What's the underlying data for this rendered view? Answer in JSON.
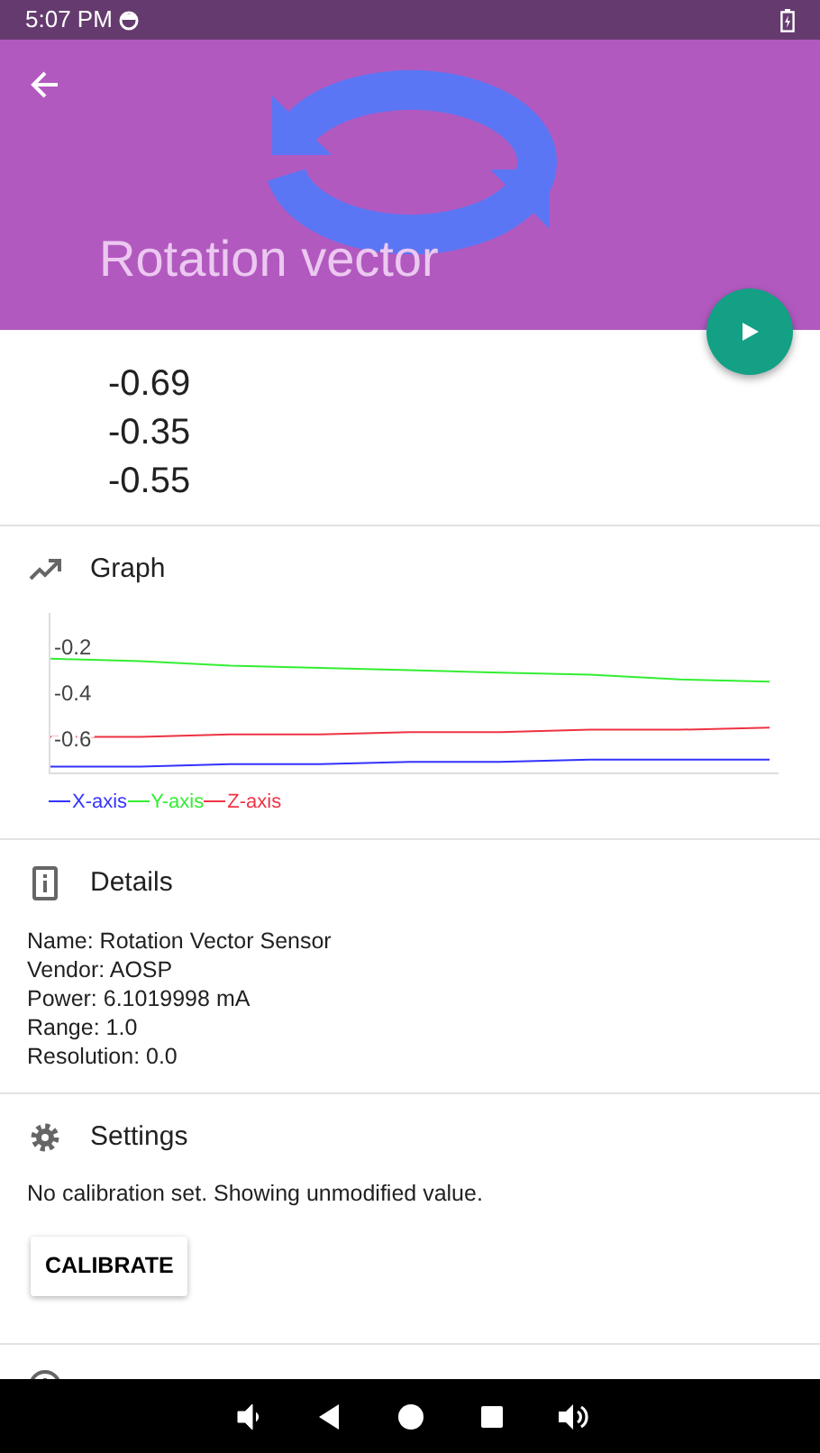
{
  "status_bar": {
    "time": "5:07 PM"
  },
  "header": {
    "title": "Rotation vector"
  },
  "values": [
    "-0.69",
    "-0.35",
    "-0.55"
  ],
  "sections": [
    {
      "kind": "graph",
      "title": "Graph",
      "chart_data": {
        "type": "line",
        "ylim": [
          -0.75,
          -0.05
        ],
        "yticks": [
          -0.2,
          -0.4,
          -0.6
        ],
        "series": [
          {
            "name": "X-axis",
            "color": "#3333ff",
            "values": [
              -0.72,
              -0.72,
              -0.71,
              -0.71,
              -0.7,
              -0.7,
              -0.69,
              -0.69,
              -0.69
            ]
          },
          {
            "name": "Y-axis",
            "color": "#33ee33",
            "values": [
              -0.25,
              -0.26,
              -0.28,
              -0.29,
              -0.3,
              -0.31,
              -0.32,
              -0.34,
              -0.35
            ]
          },
          {
            "name": "Z-axis",
            "color": "#ee3344",
            "values": [
              -0.59,
              -0.59,
              -0.58,
              -0.58,
              -0.57,
              -0.57,
              -0.56,
              -0.56,
              -0.55
            ]
          }
        ]
      }
    },
    {
      "kind": "details",
      "title": "Details",
      "lines": [
        "Name: Rotation Vector Sensor",
        "Vendor: AOSP",
        "Power: 6.1019998 mA",
        "Range: 1.0",
        "Resolution: 0.0"
      ]
    },
    {
      "kind": "settings",
      "title": "Settings",
      "lines": [
        "No calibration set. Showing unmodified value."
      ],
      "button": "CALIBRATE"
    },
    {
      "kind": "information"
    }
  ]
}
